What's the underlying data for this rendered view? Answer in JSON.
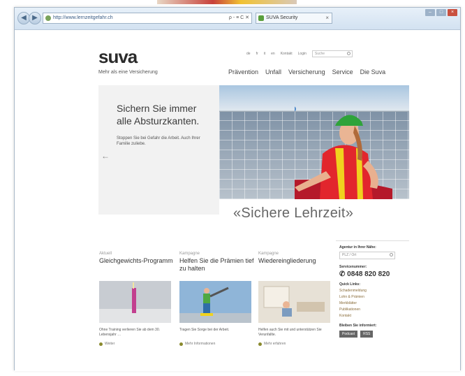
{
  "browser": {
    "address": "http://www.lernzeitgefahr.ch",
    "address_tools": "ρ - ≡ C ✕",
    "tab_title": "SUVA Security",
    "tab_close": "×"
  },
  "site": {
    "logo": "suva",
    "tagline": "Mehr als eine Versicherung",
    "utility_links": [
      "de",
      "fr",
      "it",
      "en",
      "Kontakt",
      "Login"
    ],
    "search_placeholder": "Suche",
    "nav": [
      "Prävention",
      "Unfall",
      "Versicherung",
      "Service",
      "Die Suva"
    ]
  },
  "hero": {
    "headline": "Sichern Sie immer alle Absturzkanten.",
    "subtext": "Stoppen Sie bei Gefahr die Arbeit. Auch Ihrer Familie zuliebe.",
    "arrow": "←",
    "caption": "«Sichere Lehrzeit»"
  },
  "columns": [
    {
      "kicker": "Aktuell",
      "title": "Gleichgewichts-Programm",
      "text": "Ohne Training verlieren Sie ab dem 30. Lebensjahr …",
      "link": "Weiter"
    },
    {
      "kicker": "Kampagne",
      "title": "Helfen Sie die Prämien tief zu halten",
      "text": "Tragen Sie Sorge bei der Arbeit.",
      "link": "Mehr Informationen"
    },
    {
      "kicker": "Kampagne",
      "title": "Wiedereingliederung",
      "text": "Helfen auch Sie mit und unterstützen Sie Verunfallte.",
      "link": "Mehr erfahren"
    }
  ],
  "sidebar": {
    "search_head": "Agentur in Ihrer Nähe:",
    "search_placeholder": "PLZ / Ort",
    "service_head": "Servicenummer:",
    "phone": "✆ 0848 820 820",
    "links_head": "Quick Links:",
    "links": [
      "Schadenmeldung",
      "Lohn & Prämien",
      "Merkblätter",
      "Publikationen",
      "Kontakt"
    ],
    "follow_head": "Bleiben Sie informiert:",
    "buttons": [
      "Podcast",
      "RSS"
    ]
  }
}
